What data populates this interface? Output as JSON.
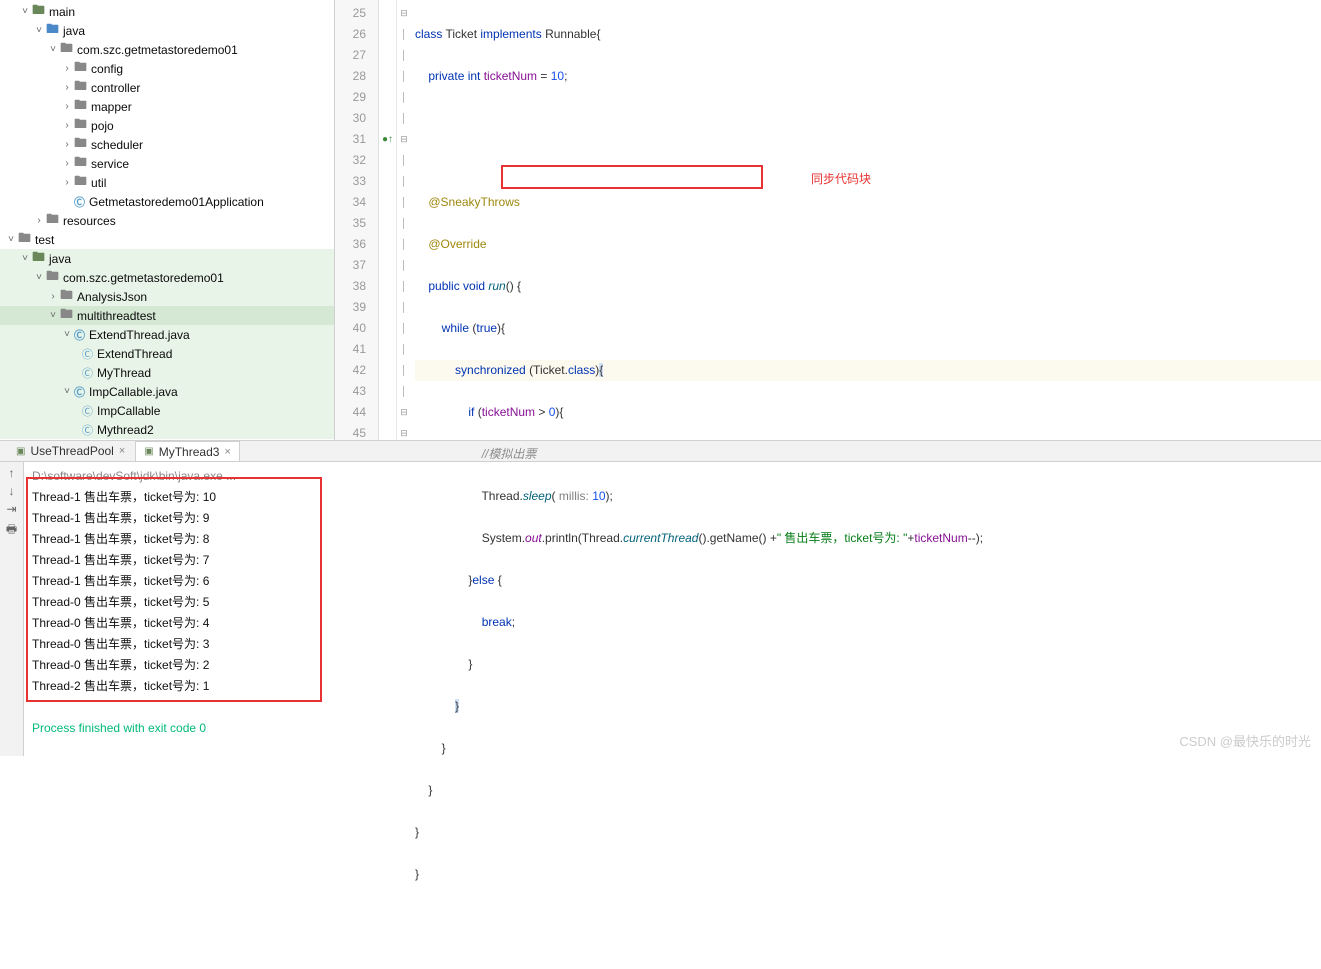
{
  "tree": {
    "main_label": "main",
    "java_label": "java",
    "pkg1": "com.szc.getmetastoredemo01",
    "config": "config",
    "controller": "controller",
    "mapper": "mapper",
    "pojo": "pojo",
    "scheduler": "scheduler",
    "service": "service",
    "util": "util",
    "app": "Getmetastoredemo01Application",
    "resources": "resources",
    "test": "test",
    "pkg2": "com.szc.getmetastoredemo01",
    "ana": "AnalysisJson",
    "multi": "multithreadtest",
    "ext_java": "ExtendThread.java",
    "ext_cls": "ExtendThread",
    "mythread": "MyThread",
    "imp_java": "ImpCallable.java",
    "imp_cls": "ImpCallable",
    "myt2": "Mythread2"
  },
  "tabs": {
    "t1": "UseThreadPool",
    "t2": "MyThread3"
  },
  "code": {
    "l25": {
      "a": "class ",
      "b": "Ticket ",
      "c": "implements ",
      "d": "Runnable{"
    },
    "l26": {
      "a": "private int ",
      "b": "ticketNum ",
      "c": "= ",
      "d": "10",
      "e": ";"
    },
    "l29": "@SneakyThrows",
    "l30": "@Override",
    "l31": {
      "a": "public void ",
      "b": "run",
      "c": "() {"
    },
    "l32": {
      "a": "while ",
      "b": "(",
      "c": "true",
      "d": "){"
    },
    "l33": {
      "a": "synchronized ",
      "b": "(Ticket.",
      "c": "class",
      "d": ")",
      "e": "{"
    },
    "l34": {
      "a": "if ",
      "b": "(",
      "c": "ticketNum ",
      "d": "> ",
      "e": "0",
      "f": "){"
    },
    "l35": "//模拟出票",
    "l36": {
      "a": "Thread.",
      "b": "sleep",
      "c": "( ",
      "d": "millis: ",
      "e": "10",
      "f": ");"
    },
    "l37": {
      "a": "System.",
      "b": "out",
      "c": ".println(Thread.",
      "d": "currentThread",
      "e": "().getName() +",
      "f": "\" 售出车票，ticket号为: \"",
      "g": "+",
      "h": "ticketNum",
      "i": "--);"
    },
    "l38": {
      "a": "}",
      "b": "else ",
      "c": "{"
    },
    "l39": {
      "a": "break",
      "b": ";"
    },
    "l40": "}",
    "l41": "}",
    "l42": "}",
    "l43": "}",
    "l44": "}",
    "l45": "}"
  },
  "annotation": "同步代码块",
  "lines": {
    "l25": "25",
    "l26": "26",
    "l27": "27",
    "l28": "28",
    "l29": "29",
    "l30": "30",
    "l31": "31",
    "l32": "32",
    "l33": "33",
    "l34": "34",
    "l35": "35",
    "l36": "36",
    "l37": "37",
    "l38": "38",
    "l39": "39",
    "l40": "40",
    "l41": "41",
    "l42": "42",
    "l43": "43",
    "l44": "44",
    "l45": "45"
  },
  "console": {
    "cmd": "D:\\software\\devSoft\\jdk\\bin\\java.exe ...",
    "lines": [
      "Thread-1 售出车票，ticket号为: 10",
      "Thread-1 售出车票，ticket号为: 9",
      "Thread-1 售出车票，ticket号为: 8",
      "Thread-1 售出车票，ticket号为: 7",
      "Thread-1 售出车票，ticket号为: 6",
      "Thread-0 售出车票，ticket号为: 5",
      "Thread-0 售出车票，ticket号为: 4",
      "Thread-0 售出车票，ticket号为: 3",
      "Thread-0 售出车票，ticket号为: 2",
      "Thread-2 售出车票，ticket号为: 1"
    ],
    "exit": "Process finished with exit code 0"
  },
  "watermark": "CSDN @最快乐的时光"
}
